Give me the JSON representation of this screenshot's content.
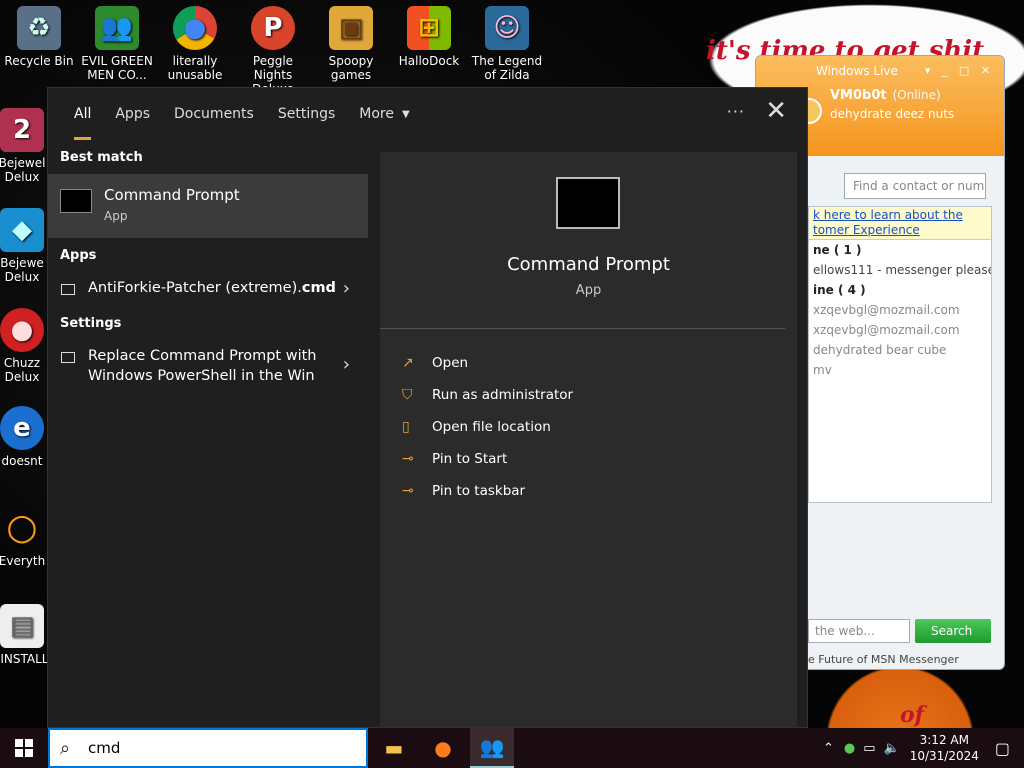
{
  "desktop": {
    "icons": [
      {
        "label": "Recycle Bin",
        "glyph": "♻"
      },
      {
        "label": "EVIL GREEN MEN CO...",
        "glyph": "👥"
      },
      {
        "label": "literally unusable",
        "glyph": "●"
      },
      {
        "label": "Peggle Nights Deluxe",
        "glyph": "P"
      },
      {
        "label": "Spoopy games",
        "glyph": "▣"
      },
      {
        "label": "HalloDock",
        "glyph": "⊞"
      },
      {
        "label": "The Legend of Zilda",
        "glyph": "☺"
      }
    ],
    "left_icons": [
      {
        "label": "Bejewel Delux",
        "glyph": "2"
      },
      {
        "label": "Bejewe Delux",
        "glyph": "◆"
      },
      {
        "label": "Chuzz Delux",
        "glyph": "●"
      },
      {
        "label": "doesnt",
        "glyph": "e"
      },
      {
        "label": "Everyth",
        "glyph": "○"
      },
      {
        "label": "!INSTALL",
        "glyph": "▤"
      }
    ],
    "wallpaper_text": "it's time to get shit",
    "wallpaper_text2": "of"
  },
  "msn": {
    "title": "Windows Live",
    "user": "VM0b0t",
    "status": "(Online)",
    "psm": "dehydrate deez nuts",
    "find_placeholder": "Find a contact or number",
    "banner": "k here to learn about the tomer Experience",
    "rows": [
      {
        "text": "ne ( 1 )",
        "kind": "group"
      },
      {
        "text": "ellows111 - messenger please",
        "kind": "on"
      },
      {
        "text": "ine ( 4 )",
        "kind": "group"
      },
      {
        "text": "xzqevbgl@mozmail.com",
        "kind": "off"
      },
      {
        "text": "xzqevbgl@mozmail.com",
        "kind": "off"
      },
      {
        "text": "dehydrated bear cube",
        "kind": "off"
      },
      {
        "text": "mv",
        "kind": "off"
      }
    ],
    "web_placeholder": "the web...",
    "search_btn": "Search",
    "footer": "e Future of MSN Messenger"
  },
  "search_panel": {
    "tabs": [
      "All",
      "Apps",
      "Documents",
      "Settings",
      "More"
    ],
    "best_match_header": "Best match",
    "best_match": {
      "name": "Command Prompt",
      "type": "App"
    },
    "apps_header": "Apps",
    "apps_item": {
      "name": "AntiForkie-Patcher (extreme).",
      "bold": "cmd"
    },
    "settings_header": "Settings",
    "settings_item": "Replace Command Prompt with Windows PowerShell in the Win",
    "detail": {
      "name": "Command Prompt",
      "type": "App"
    },
    "actions": [
      "Open",
      "Run as administrator",
      "Open file location",
      "Pin to Start",
      "Pin to taskbar"
    ]
  },
  "taskbar": {
    "search_query": "cmd",
    "time": "3:12 AM",
    "date": "10/31/2024"
  }
}
